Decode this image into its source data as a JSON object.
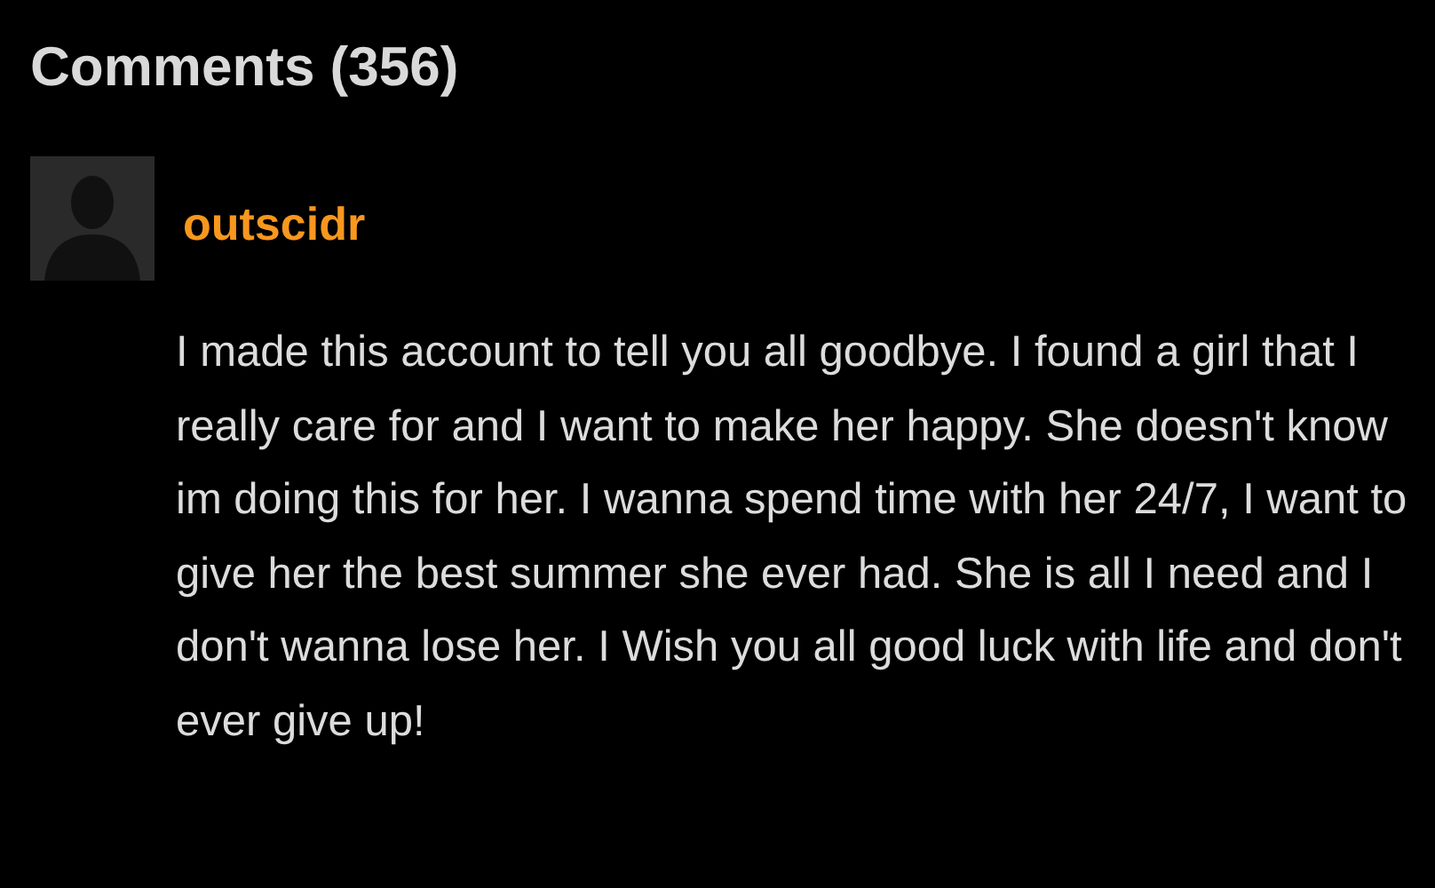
{
  "header": {
    "title": "Comments (356)"
  },
  "comments": [
    {
      "username": "outscidr",
      "text": "I made this account to tell you all goodbye. I found a girl that I really care for and I want to make her happy. She doesn't know im doing this for her. I wanna spend time with her 24/7, I want to give her the best summer she ever had. She is all I need and I don't wanna lose her. I Wish you all good luck with life and don't ever give up!"
    }
  ]
}
